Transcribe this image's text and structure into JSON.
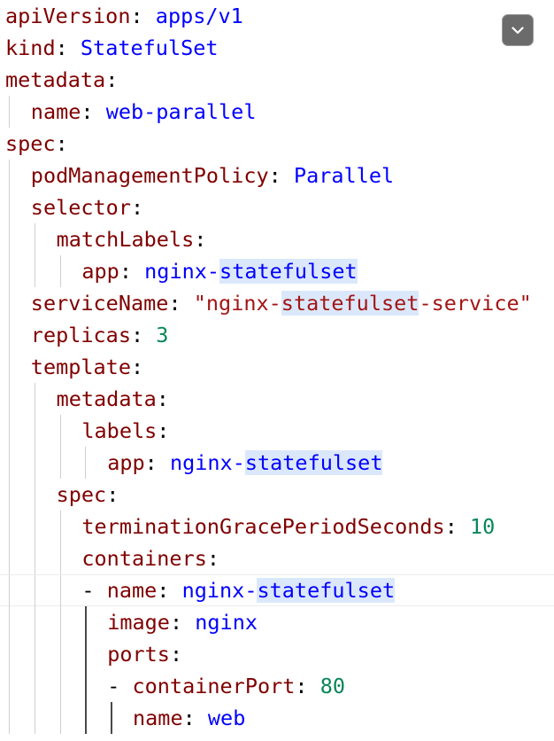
{
  "editor": {
    "language": "yaml",
    "lines": [
      {
        "indent": 0,
        "key": "apiVersion",
        "value": "apps/v1",
        "value_type": "plain"
      },
      {
        "indent": 0,
        "key": "kind",
        "value": "StatefulSet",
        "value_type": "plain"
      },
      {
        "indent": 0,
        "key": "metadata",
        "value": "",
        "value_type": "none"
      },
      {
        "indent": 1,
        "key": "name",
        "value": "web-parallel",
        "value_type": "plain"
      },
      {
        "indent": 0,
        "key": "spec",
        "value": "",
        "value_type": "none"
      },
      {
        "indent": 1,
        "key": "podManagementPolicy",
        "value": "Parallel",
        "value_type": "plain"
      },
      {
        "indent": 1,
        "key": "selector",
        "value": "",
        "value_type": "none"
      },
      {
        "indent": 2,
        "key": "matchLabels",
        "value": "",
        "value_type": "none"
      },
      {
        "indent": 3,
        "key": "app",
        "value": "nginx-statefulset",
        "value_type": "plain",
        "highlight": "statefulset"
      },
      {
        "indent": 1,
        "key": "serviceName",
        "value": "\"nginx-statefulset-service\"",
        "value_type": "string",
        "highlight": "statefulset"
      },
      {
        "indent": 1,
        "key": "replicas",
        "value": "3",
        "value_type": "number"
      },
      {
        "indent": 1,
        "key": "template",
        "value": "",
        "value_type": "none"
      },
      {
        "indent": 2,
        "key": "metadata",
        "value": "",
        "value_type": "none"
      },
      {
        "indent": 3,
        "key": "labels",
        "value": "",
        "value_type": "none"
      },
      {
        "indent": 4,
        "key": "app",
        "value": "nginx-statefulset",
        "value_type": "plain",
        "highlight": "statefulset"
      },
      {
        "indent": 2,
        "key": "spec",
        "value": "",
        "value_type": "none"
      },
      {
        "indent": 3,
        "key": "terminationGracePeriodSeconds",
        "value": "10",
        "value_type": "number"
      },
      {
        "indent": 3,
        "key": "containers",
        "value": "",
        "value_type": "none"
      },
      {
        "indent": 3,
        "dash": true,
        "key": "name",
        "value": "nginx-statefulset",
        "value_type": "plain",
        "highlight": "statefulset",
        "current": true
      },
      {
        "indent": 4,
        "key": "image",
        "value": "nginx",
        "value_type": "plain"
      },
      {
        "indent": 4,
        "key": "ports",
        "value": "",
        "value_type": "none"
      },
      {
        "indent": 4,
        "dash": true,
        "key": "containerPort",
        "value": "80",
        "value_type": "number"
      },
      {
        "indent": 5,
        "key": "name",
        "value": "web",
        "value_type": "plain"
      }
    ]
  },
  "fold_button": {
    "icon": "chevron-down-icon"
  },
  "colors": {
    "key": "#800000",
    "plain_value": "#0000ff",
    "number": "#098658",
    "string": "#a31515",
    "selection_highlight": "#dbe8fb",
    "indent_guide": "#cfcfcf",
    "active_indent_guide": "#4a4a4a",
    "fold_button_bg": "#6b6b6b"
  }
}
